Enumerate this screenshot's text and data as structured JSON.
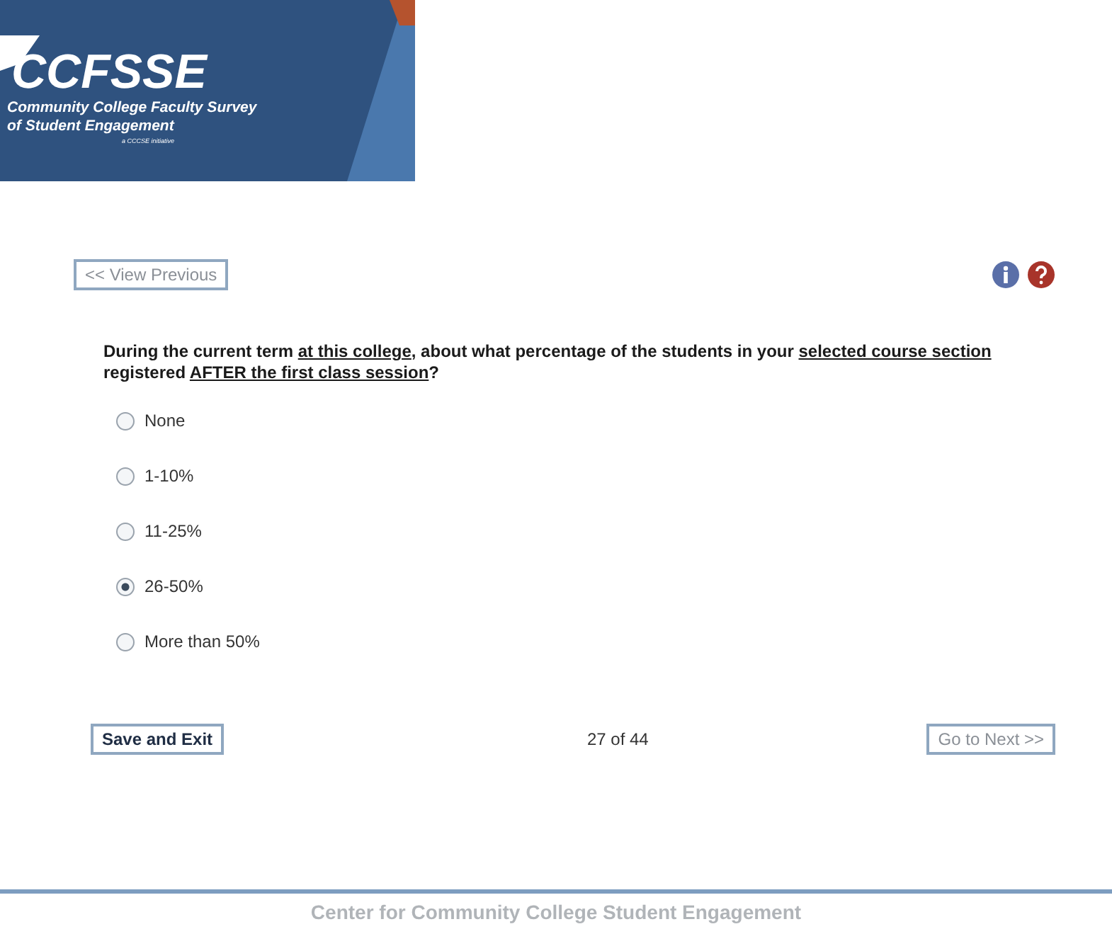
{
  "logo": {
    "acronym": "CCFSSE",
    "name_line_1": "Community College Faculty Survey",
    "name_line_2": "of Student Engagement",
    "tagline": "a CCCSE initiative"
  },
  "previous_button": {
    "label": "<< View Previous",
    "disabled": true
  },
  "question": [
    {
      "text": "During the current term ",
      "underlined": false
    },
    {
      "text": "at this college",
      "underlined": true
    },
    {
      "text": ", about what percentage of the students in your ",
      "underlined": false
    },
    {
      "text": "selected course section",
      "underlined": true
    },
    {
      "text": " registered ",
      "underlined": false
    },
    {
      "text": "AFTER the first class session",
      "underlined": true
    },
    {
      "text": "?",
      "underlined": false
    }
  ],
  "options": [
    {
      "label": "None",
      "selected": false
    },
    {
      "label": "1-10%",
      "selected": false
    },
    {
      "label": "11-25%",
      "selected": false
    },
    {
      "label": "26-50%",
      "selected": true
    },
    {
      "label": "More than 50%",
      "selected": false
    }
  ],
  "save_button": {
    "label": "Save and Exit",
    "disabled": false
  },
  "progress": "27 of 44",
  "next_button": {
    "label": "Go to Next >>",
    "disabled": true
  },
  "footer": "Center for Community College Student Engagement"
}
